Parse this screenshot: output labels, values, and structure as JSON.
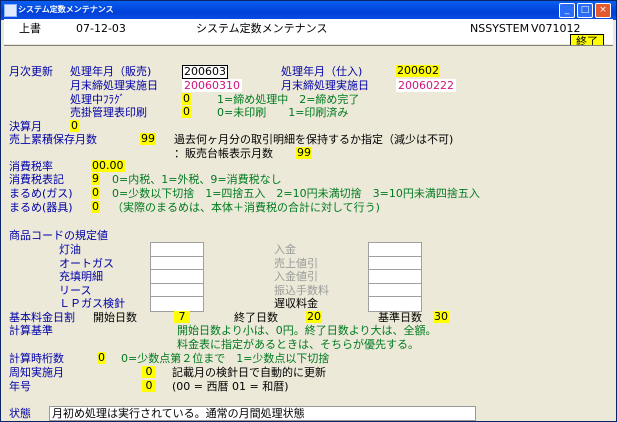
{
  "window": {
    "title": "システム定数メンテナンス"
  },
  "header": {
    "mode": "上書",
    "date": "07-12-03",
    "screen_title": "システム定数メンテナンス",
    "system_id": "NSSYSTEM",
    "version": "V071012",
    "end_button": "終了"
  },
  "monthly": {
    "section_label": "月次更新",
    "sales_month_label": "処理年月（販売)",
    "sales_month_value": "200603",
    "purchase_month_label": "処理年月（仕入)",
    "purchase_month_value": "200602",
    "sales_close_date_label": "月末締処理実施日",
    "sales_close_date_value": "20060310",
    "purchase_close_date_label": "月末締処理実施日",
    "purchase_close_date_value": "20060222",
    "processing_flag_label": "処理中ﾌﾗｸﾞ",
    "processing_flag_value": "0",
    "processing_flag_desc": "1=締め処理中　2=締め完了",
    "receivable_print_label": "売掛管理表印刷",
    "receivable_print_value": "0",
    "receivable_print_desc": "0=未印刷　　1=印刷済み"
  },
  "settlement": {
    "label": "決算月",
    "value": "0"
  },
  "sales_history": {
    "label": "売上累積保存月数",
    "value": "99",
    "desc": "過去何ヶ月分の取引明細を保持するか指定（減少は不可)",
    "ledger_label": "：販売台帳表示月数",
    "ledger_value": "99"
  },
  "tax": {
    "rate_label": "消費税率",
    "rate_value": "00.00",
    "notation_label": "消費税表記",
    "notation_value": "9",
    "notation_desc": "0=内税、1=外税、9=消費税なし",
    "round_gas_label": "まるめ(ガス)",
    "round_gas_value": "0",
    "round_gas_desc": "0=少数以下切捨　1=四捨五入　2=10円未満切捨　3=10円未満四捨五入",
    "round_equip_label": "まるめ(器具)",
    "round_equip_value": "0",
    "round_equip_desc": "（実際のまるめは、本体＋消費税の合計に対して行う)"
  },
  "product_codes": {
    "section_label": "商品コードの規定値",
    "left_items": [
      "灯油",
      "オートガス",
      "充填明細",
      "リース",
      "ＬＰガス検針"
    ],
    "right_items": [
      "入金",
      "売上値引",
      "入金値引",
      "振込手数料",
      "遅収料金"
    ]
  },
  "basic_fee": {
    "label": "基本料金日割",
    "start_label": "開始日数",
    "start_value": "7",
    "end_label": "終了日数",
    "end_value": "20",
    "base_label": "基準日数",
    "base_value": "30",
    "calc_label": "計算基準",
    "calc_desc1": "開始日数より小は、0円。終了日数より大は、全額。",
    "calc_desc2": "料金表に指定があるときは、そちらが優先する。"
  },
  "misc": {
    "digits_label": "計算時桁数",
    "digits_value": "0",
    "digits_desc": "0=少数点第２位まで　1=少数点以下切捨",
    "notice_label": "周知実施月",
    "notice_value": "0",
    "notice_desc": "記載月の検針日で自動的に更新",
    "era_label": "年号",
    "era_value": "0",
    "era_desc": "(00 = 西暦 01 = 和暦)"
  },
  "status": {
    "label": "状態",
    "text": "月初め処理は実行されている。通常の月間処理状態"
  }
}
